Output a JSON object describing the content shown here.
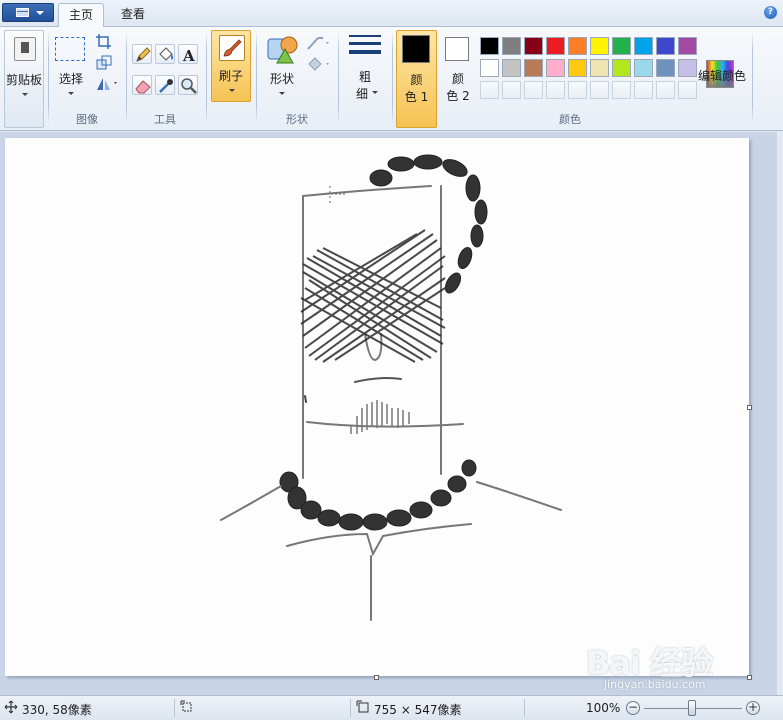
{
  "app_menu": {
    "icon": "app-menu-icon"
  },
  "tabs": {
    "home": "主页",
    "view": "查看"
  },
  "ribbon": {
    "clipboard": {
      "label": "剪贴板"
    },
    "image": {
      "select_label": "选择",
      "group_label": "图像"
    },
    "tools": {
      "group_label": "工具"
    },
    "brushes": {
      "label": "刷子"
    },
    "shapes": {
      "label": "形状",
      "group_label": "形状"
    },
    "size": {
      "label_line1": "粗",
      "label_line2": "细"
    },
    "colors": {
      "color1_line1": "颜",
      "color1_line2": "色 1",
      "color2_line1": "颜",
      "color2_line2": "色 2",
      "color1_value": "#000000",
      "color2_value": "#ffffff",
      "edit_label": "编辑颜色",
      "group_label": "颜色",
      "palette_row1": [
        "#000000",
        "#7f7f7f",
        "#880015",
        "#ed1c24",
        "#ff7f27",
        "#fff200",
        "#22b14c",
        "#00a2e8",
        "#3f48cc",
        "#a349a4"
      ],
      "palette_row2": [
        "#ffffff",
        "#c3c3c3",
        "#b97a57",
        "#ffaec9",
        "#ffc90e",
        "#efe4b0",
        "#b5e61d",
        "#99d9ea",
        "#7092be",
        "#c8bfe7"
      ]
    }
  },
  "status": {
    "cursor_position": "330, 58像素",
    "image_size": "755 × 547像素",
    "zoom": "100%",
    "zoom_level": 100
  },
  "watermark": {
    "main": "Bai 经验",
    "sub": "jingyan.baidu.com"
  }
}
